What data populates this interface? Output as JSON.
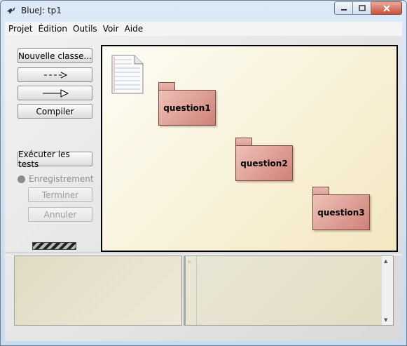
{
  "window": {
    "title": "BlueJ:  tp1"
  },
  "menu": [
    "Projet",
    "Édition",
    "Outils",
    "Voir",
    "Aide"
  ],
  "toolbar": {
    "new_class": "Nouvelle classe...",
    "compile": "Compiler"
  },
  "testing": {
    "run_tests": "Exécuter les tests",
    "recording": "Enregistrement",
    "end": "Terminer",
    "cancel": "Annuler"
  },
  "packages": [
    "question1",
    "question2",
    "question3"
  ],
  "icons": {
    "app": "bluej-bird-icon",
    "readme": "readme-document-icon",
    "dependency_arrow": "dashed-arrow-icon",
    "inheritance_arrow": "inheritance-arrow-icon"
  },
  "colors": {
    "package_fill": "#dd9e95",
    "canvas_bg": "#f8f0d6",
    "close_button": "#c9513a"
  }
}
